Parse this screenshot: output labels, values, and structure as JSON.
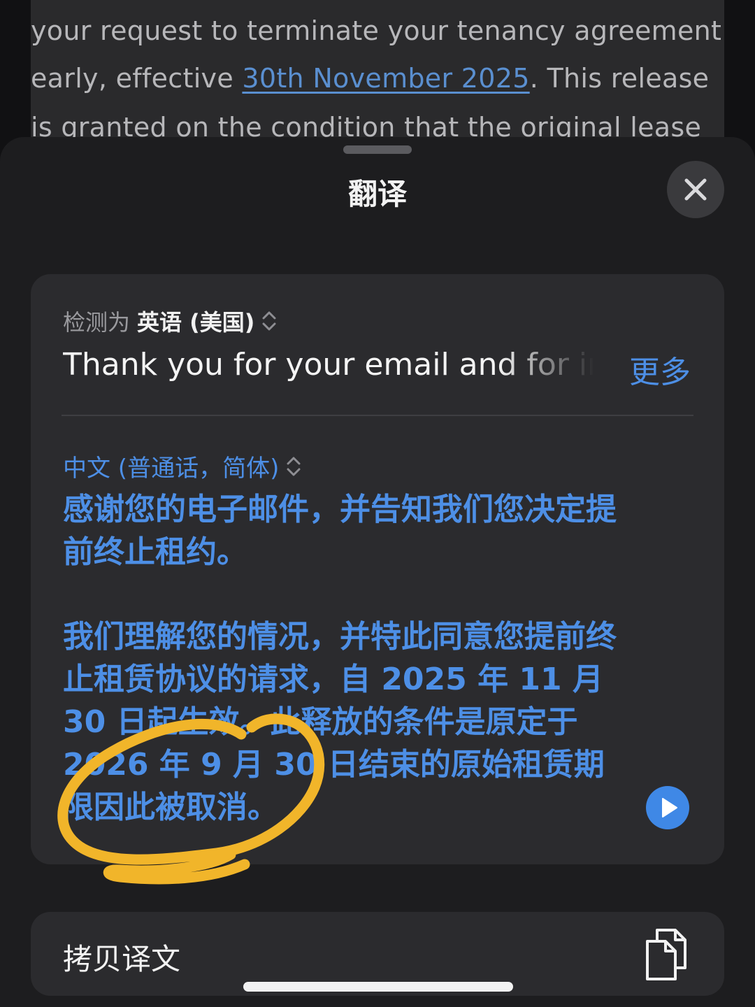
{
  "background_doc": {
    "line1": "your request to terminate your tenancy agreement",
    "line2_before": "early, effective ",
    "line2_link": "30th November 2025",
    "line2_after": ". This release",
    "line3": "is granted on the condition that the original lease"
  },
  "sheet": {
    "title": "翻译",
    "close_icon": "close-icon"
  },
  "source": {
    "detect_prefix": "检测为",
    "detect_language": "英语 (美国)",
    "text": "Thank you for your email and for informing us",
    "more_label": "更多"
  },
  "target": {
    "language": "中文 (普通话，简体)",
    "paragraph1": "感谢您的电子邮件，并告知我们您决定提前终止租约。",
    "paragraph2": "我们理解您的情况，并特此同意您提前终止租赁协议的请求，自 2025 年 11 月 30 日起生效。此释放的条件是原定于 2026 年 9 月 30 日结束的原始租赁期限因此被取消。",
    "play_icon": "play-icon"
  },
  "actions": {
    "copy_label": "拷贝译文",
    "copy_icon": "copy-icon"
  },
  "colors": {
    "accent": "#4d8fe6",
    "sheet_bg": "#1d1d1f",
    "card_bg": "#2b2b2e",
    "annotation": "#f1b52a"
  }
}
